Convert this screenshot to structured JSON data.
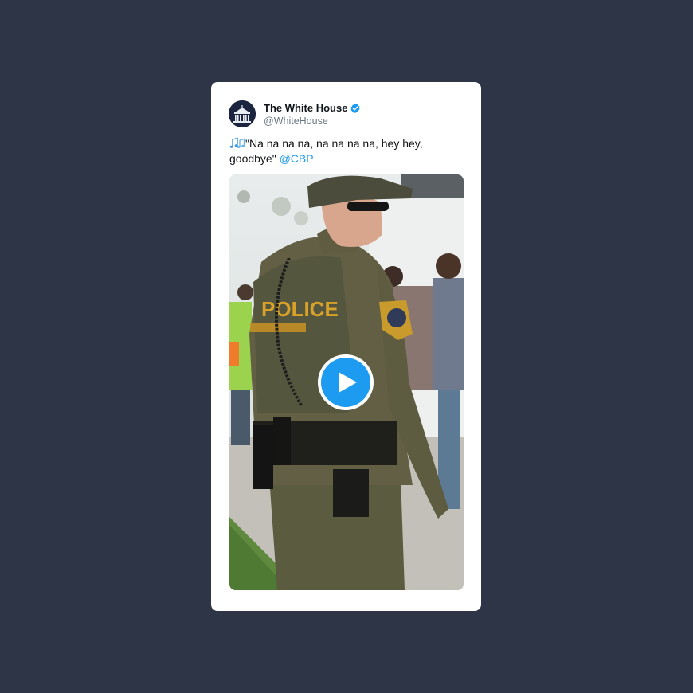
{
  "tweet": {
    "author": {
      "display_name": "The White House",
      "handle": "@WhiteHouse",
      "verified": true,
      "avatar_icon": "white-house-building-icon"
    },
    "text": {
      "emoji_icon": "musical-notes-icon",
      "body": "\"Na na na na, na na na na, hey hey, goodbye\"",
      "mention": "@CBP"
    },
    "media": {
      "type": "video",
      "play_icon": "play-icon",
      "patch_text": "POLICE"
    }
  },
  "colors": {
    "background": "#2e3546",
    "card": "#ffffff",
    "accent": "#1d9bf0",
    "text_primary": "#0f1419",
    "text_secondary": "#687684"
  }
}
